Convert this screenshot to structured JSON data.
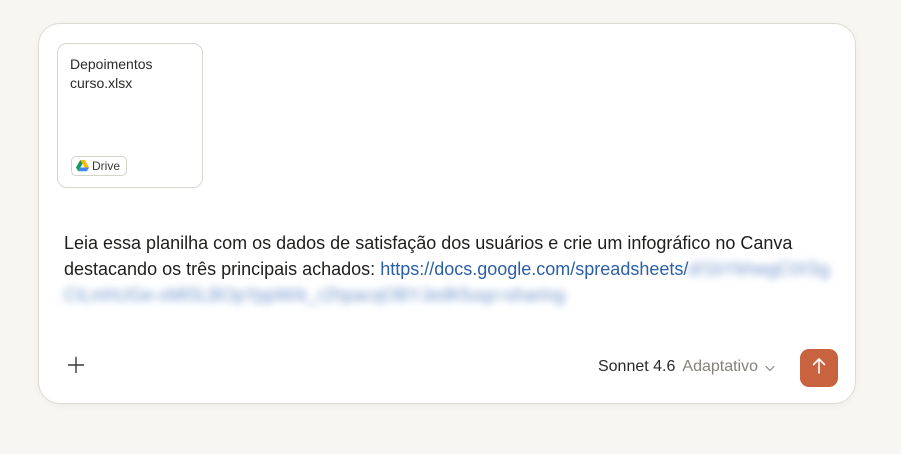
{
  "attachment": {
    "filename": "Depoimentos\ncurso.xlsx",
    "source_label": "Drive"
  },
  "prompt": {
    "text": "Leia essa planilha com os dados de satisfação dos usuários e crie um infográfico no Canva destacando os três principais achados: ",
    "link_visible": "https://docs.google.com/spreadsheets/",
    "link_blurred": "d/1bYkhwgCtXSgCiLmhUGe-xMlSLBOpYppWrk_r2hpacqOBYJedKfusp=sharing"
  },
  "model": {
    "name": "Sonnet 4.6",
    "mode": "Adaptativo"
  },
  "icons": {
    "add": "plus-icon",
    "drive": "google-drive-icon",
    "dropdown": "chevron-down-icon",
    "send": "arrow-up-icon"
  },
  "colors": {
    "send_button": "#c9633f",
    "link": "#2a5fa8"
  }
}
